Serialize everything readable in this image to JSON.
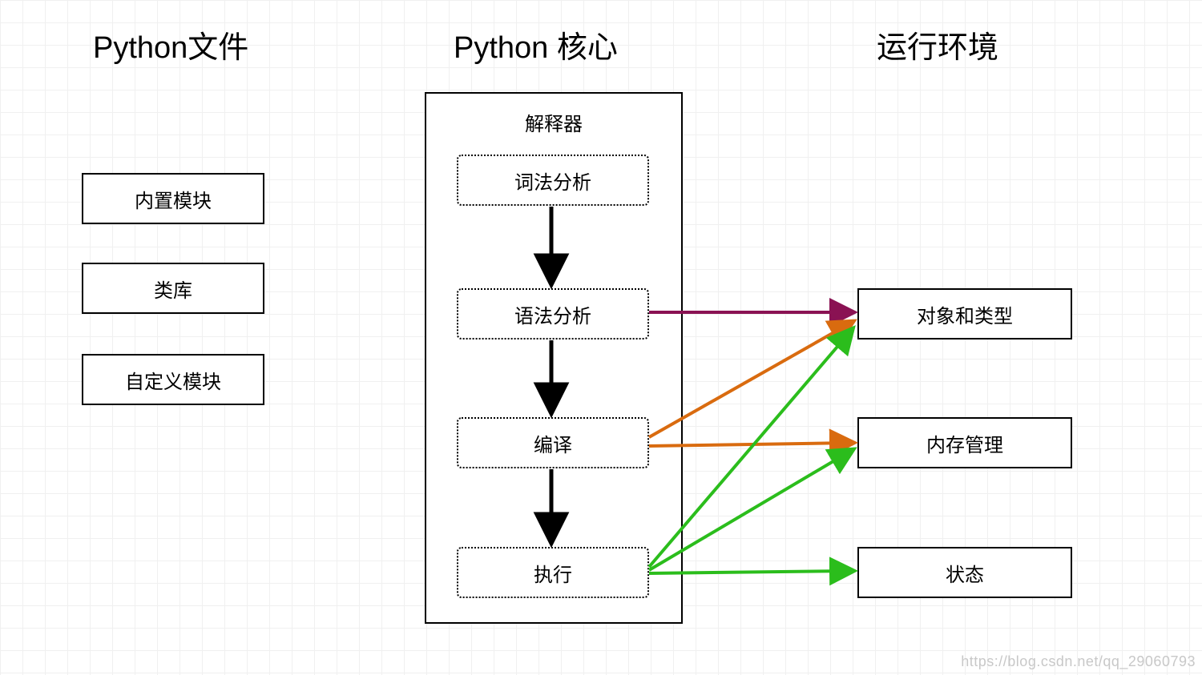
{
  "columns": {
    "left": {
      "heading": "Python文件"
    },
    "center": {
      "heading": "Python 核心"
    },
    "right": {
      "heading": "运行环境"
    }
  },
  "left_boxes": {
    "builtin": "内置模块",
    "libs": "类库",
    "custom": "自定义模块"
  },
  "interpreter": {
    "title": "解释器",
    "steps": {
      "lex": "词法分析",
      "parse": "语法分析",
      "compile": "编译",
      "execute": "执行"
    }
  },
  "right_boxes": {
    "objects": "对象和类型",
    "memory": "内存管理",
    "state": "状态"
  },
  "colors": {
    "arrow_black": "#000000",
    "arrow_purple": "#8a1253",
    "arrow_orange": "#d96b0f",
    "arrow_green": "#2bbd1c"
  },
  "watermark": "https://blog.csdn.net/qq_29060793"
}
